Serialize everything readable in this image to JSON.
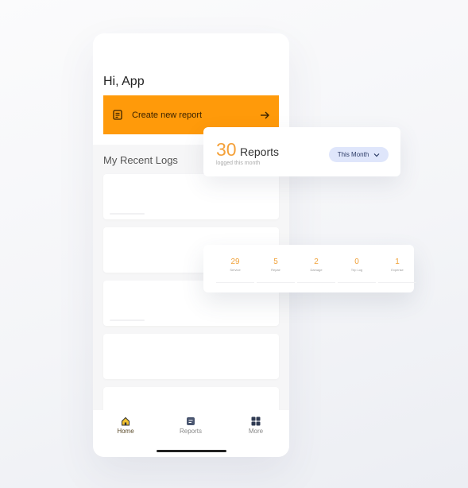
{
  "home": {
    "greeting": "Hi, App",
    "create_button": {
      "label": "Create new report"
    },
    "recent_logs_title": "My Recent Logs"
  },
  "tabbar": {
    "items": [
      {
        "label": "Home",
        "icon": "home-icon"
      },
      {
        "label": "Reports",
        "icon": "reports-icon"
      },
      {
        "label": "More",
        "icon": "grid-icon"
      }
    ]
  },
  "reports_card": {
    "count": "30",
    "unit": "Reports",
    "subtitle": "logged this month",
    "period": "This Month"
  },
  "stats_card": {
    "items": [
      {
        "value": "29",
        "label": "Service"
      },
      {
        "value": "5",
        "label": "Repair"
      },
      {
        "value": "2",
        "label": "Damage"
      },
      {
        "value": "0",
        "label": "Trip Log"
      },
      {
        "value": "1",
        "label": "Expense"
      }
    ]
  },
  "colors": {
    "accent": "#ff9a0a",
    "count": "#f4a13a",
    "pill": "#dfe6fb"
  }
}
